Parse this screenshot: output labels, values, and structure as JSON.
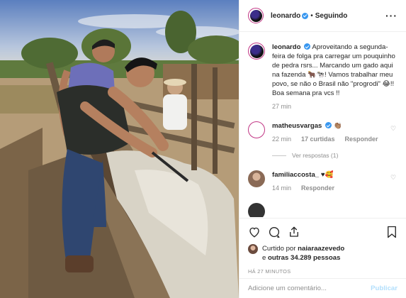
{
  "post": {
    "author": "leonardo",
    "separator": "•",
    "follow_status": "Seguindo",
    "caption": "Aproveitando a segunda-feira de folga pra carregar um pouquinho de pedra rsrs... Marcando um gado aqui na fazenda 🐂🐄! Vamos trabalhar meu povo, se não o Brasil não \"progrodi\" 😂!! Boa semana pra vcs !!",
    "caption_time": "27 min"
  },
  "comments": [
    {
      "user": "matheusvargas",
      "text": "👏🏽",
      "time": "22 min",
      "likes": "17 curtidas",
      "reply": "Responder",
      "view_replies": "Ver respostas (1)"
    },
    {
      "user": "familiaccosta_",
      "text": "♥🥰",
      "time": "14 min",
      "reply": "Responder"
    }
  ],
  "likes": {
    "prefix": "Curtido por",
    "user": "naiaraazevedo",
    "connector": "e",
    "others": "outras 34.289 pessoas"
  },
  "timestamp": "HÁ 27 MINUTOS",
  "comment_box": {
    "placeholder": "Adicione um comentário...",
    "publish": "Publicar"
  },
  "icons": {
    "like": "heart-icon",
    "comment": "comment-icon",
    "share": "share-icon",
    "save": "bookmark-icon",
    "more": "more-icon"
  },
  "colors": {
    "verified": "#3897f0",
    "muted": "#8e8e8e",
    "publish_disabled": "#b2dffc"
  }
}
